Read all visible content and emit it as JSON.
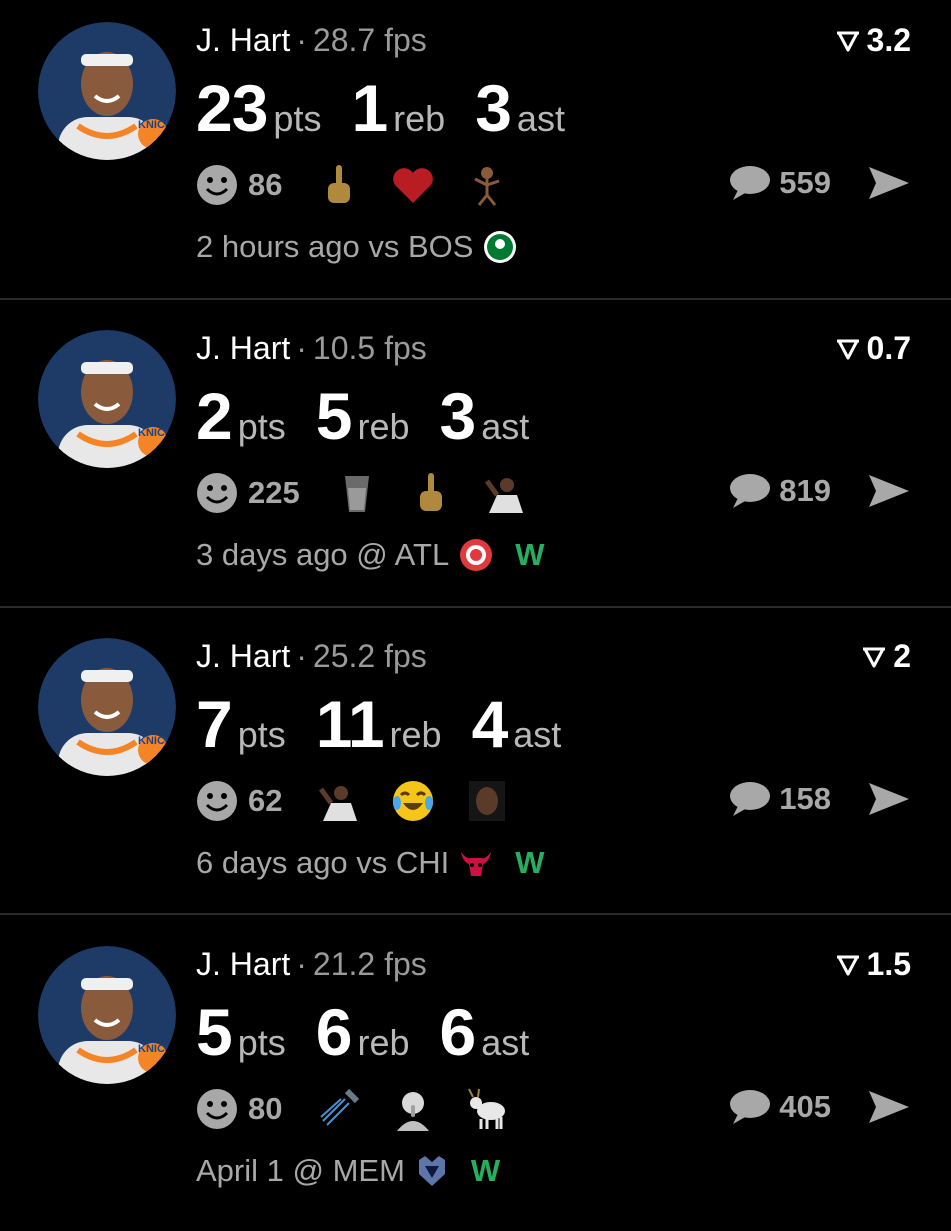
{
  "cards": [
    {
      "player": "J. Hart",
      "fps": "28.7 fps",
      "score": "3.2",
      "pts": "23",
      "pts_label": "pts",
      "reb": "1",
      "reb_label": "reb",
      "ast": "3",
      "ast_label": "ast",
      "reaction_count": "86",
      "reactions": [
        "middle-finger-icon",
        "heart-icon",
        "bird-figure-icon"
      ],
      "comment_count": "559",
      "time": "2 hours ago",
      "matchup": "vs BOS",
      "opponent_logo": "celtics-logo-icon",
      "result": ""
    },
    {
      "player": "J. Hart",
      "fps": "10.5 fps",
      "score": "0.7",
      "pts": "2",
      "pts_label": "pts",
      "reb": "5",
      "reb_label": "reb",
      "ast": "3",
      "ast_label": "ast",
      "reaction_count": "225",
      "reactions": [
        "glass-of-water-icon",
        "middle-finger-icon",
        "flexing-person-icon"
      ],
      "comment_count": "819",
      "time": "3 days ago",
      "matchup": "@ ATL",
      "opponent_logo": "hawks-logo-icon",
      "result": "W"
    },
    {
      "player": "J. Hart",
      "fps": "25.2 fps",
      "score": "2",
      "pts": "7",
      "pts_label": "pts",
      "reb": "11",
      "reb_label": "reb",
      "ast": "4",
      "ast_label": "ast",
      "reaction_count": "62",
      "reactions": [
        "flexing-person-icon",
        "tears-of-joy-icon",
        "player-face-icon"
      ],
      "comment_count": "158",
      "time": "6 days ago",
      "matchup": "vs CHI",
      "opponent_logo": "bulls-logo-icon",
      "result": "W"
    },
    {
      "player": "J. Hart",
      "fps": "21.2 fps",
      "score": "1.5",
      "pts": "5",
      "pts_label": "pts",
      "reb": "6",
      "reb_label": "reb",
      "ast": "6",
      "ast_label": "ast",
      "reaction_count": "80",
      "reactions": [
        "shower-head-icon",
        "shushing-face-icon",
        "goat-icon"
      ],
      "comment_count": "405",
      "time": "April 1",
      "matchup": "@ MEM",
      "opponent_logo": "grizzlies-logo-icon",
      "result": "W"
    }
  ],
  "colors": {
    "background": "#000000",
    "muted_text": "#a8a8a8",
    "win_green": "#27ae60",
    "divider": "#2a2a2a"
  }
}
